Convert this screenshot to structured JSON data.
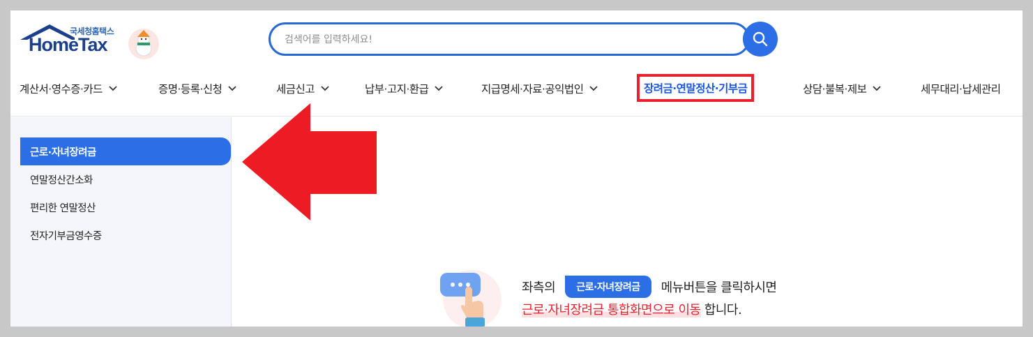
{
  "logo": {
    "sub": "국세청홈택스",
    "main": "HomeTax"
  },
  "search": {
    "placeholder": "검색어를 입력하세요!"
  },
  "nav": {
    "items": [
      {
        "label": "계산서·영수증·카드",
        "has_chevron": true
      },
      {
        "label": "증명·등록·신청",
        "has_chevron": true
      },
      {
        "label": "세금신고",
        "has_chevron": true
      },
      {
        "label": "납부·고지·환급",
        "has_chevron": true
      },
      {
        "label": "지급명세·자료·공익법인",
        "has_chevron": true
      },
      {
        "label": "장려금·연말정산·기부금",
        "has_chevron": false,
        "active": true
      },
      {
        "label": "상담·불복·제보",
        "has_chevron": true
      },
      {
        "label": "세무대리·납세관리",
        "has_chevron": false
      }
    ]
  },
  "sidebar": {
    "items": [
      {
        "label": "근로·자녀장려금",
        "active": true
      },
      {
        "label": "연말정산간소화"
      },
      {
        "label": "편리한 연말정산"
      },
      {
        "label": "전자기부금영수증"
      }
    ]
  },
  "info": {
    "prefix": "좌측의",
    "badge": "근로·자녀장려금",
    "suffix": "메뉴버튼을 클릭하시면",
    "highlight": "근로·자녀장려금 통합화면으로 이동",
    "tail": " 합니다."
  },
  "colors": {
    "accent": "#2b6ee6",
    "highlight_border": "#e8212e",
    "arrow": "#ed1c24"
  }
}
